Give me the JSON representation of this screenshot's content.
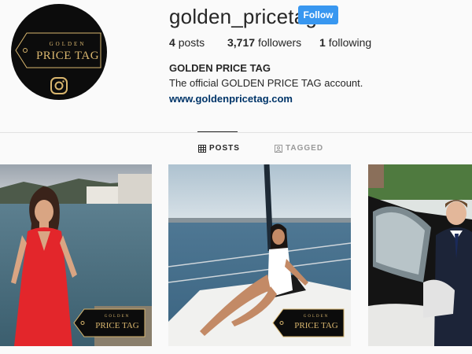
{
  "profile": {
    "username": "golden_pricetag",
    "follow_label": "Follow",
    "stats": {
      "posts_count": "4",
      "posts_label": "posts",
      "followers_count": "3,717",
      "followers_label": "followers",
      "following_count": "1",
      "following_label": "following"
    },
    "full_name": "GOLDEN PRICE TAG",
    "bio": "The official GOLDEN PRICE TAG account.",
    "website": "www.goldenpricetag.com"
  },
  "avatar": {
    "logo_line1": "GOLDEN",
    "logo_line2": "PRICE TAG"
  },
  "tabs": [
    {
      "label": "POSTS",
      "icon": "grid-icon",
      "active": true
    },
    {
      "label": "TAGGED",
      "icon": "tagged-icon",
      "active": false
    }
  ],
  "watermark": {
    "line1": "GOLDEN",
    "line2": "PRICE TAG"
  },
  "colors": {
    "follow_button": "#3897f0",
    "link": "#003569",
    "gold": "#d9b66e",
    "background": "#fafafa"
  }
}
